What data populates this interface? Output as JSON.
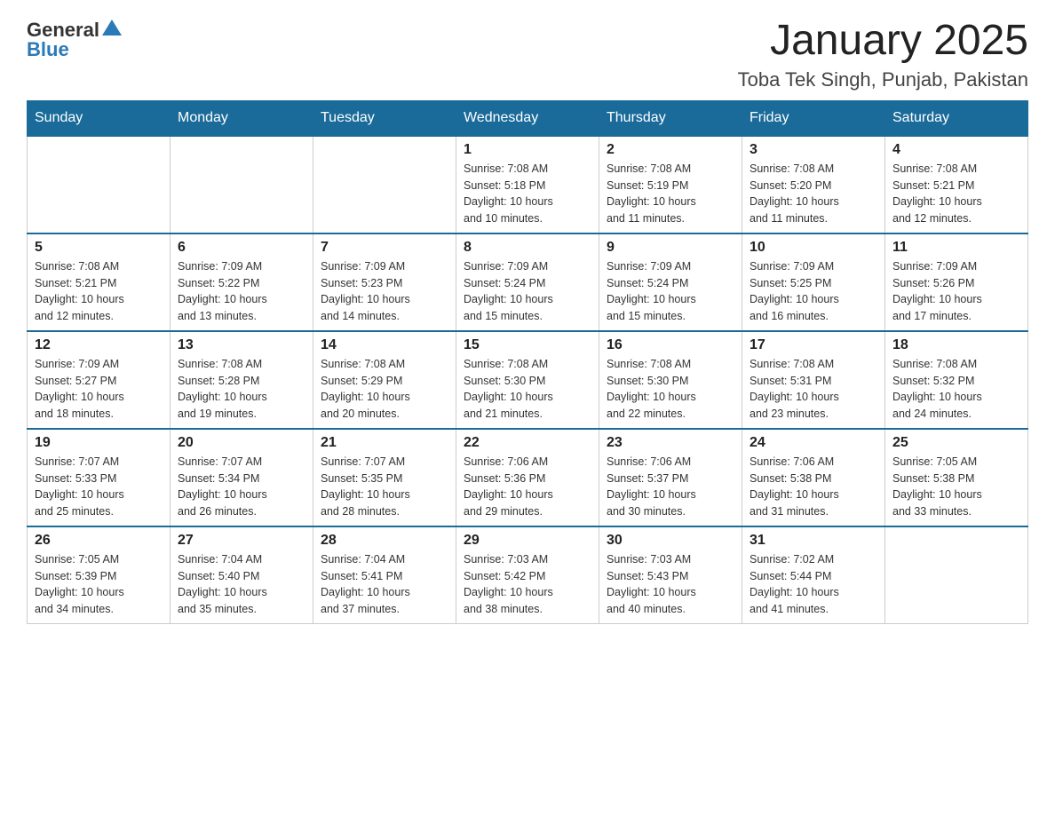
{
  "header": {
    "logo_general": "General",
    "logo_blue": "Blue",
    "month_title": "January 2025",
    "location": "Toba Tek Singh, Punjab, Pakistan"
  },
  "days_of_week": [
    "Sunday",
    "Monday",
    "Tuesday",
    "Wednesday",
    "Thursday",
    "Friday",
    "Saturday"
  ],
  "weeks": [
    [
      {
        "day": "",
        "info": ""
      },
      {
        "day": "",
        "info": ""
      },
      {
        "day": "",
        "info": ""
      },
      {
        "day": "1",
        "info": "Sunrise: 7:08 AM\nSunset: 5:18 PM\nDaylight: 10 hours\nand 10 minutes."
      },
      {
        "day": "2",
        "info": "Sunrise: 7:08 AM\nSunset: 5:19 PM\nDaylight: 10 hours\nand 11 minutes."
      },
      {
        "day": "3",
        "info": "Sunrise: 7:08 AM\nSunset: 5:20 PM\nDaylight: 10 hours\nand 11 minutes."
      },
      {
        "day": "4",
        "info": "Sunrise: 7:08 AM\nSunset: 5:21 PM\nDaylight: 10 hours\nand 12 minutes."
      }
    ],
    [
      {
        "day": "5",
        "info": "Sunrise: 7:08 AM\nSunset: 5:21 PM\nDaylight: 10 hours\nand 12 minutes."
      },
      {
        "day": "6",
        "info": "Sunrise: 7:09 AM\nSunset: 5:22 PM\nDaylight: 10 hours\nand 13 minutes."
      },
      {
        "day": "7",
        "info": "Sunrise: 7:09 AM\nSunset: 5:23 PM\nDaylight: 10 hours\nand 14 minutes."
      },
      {
        "day": "8",
        "info": "Sunrise: 7:09 AM\nSunset: 5:24 PM\nDaylight: 10 hours\nand 15 minutes."
      },
      {
        "day": "9",
        "info": "Sunrise: 7:09 AM\nSunset: 5:24 PM\nDaylight: 10 hours\nand 15 minutes."
      },
      {
        "day": "10",
        "info": "Sunrise: 7:09 AM\nSunset: 5:25 PM\nDaylight: 10 hours\nand 16 minutes."
      },
      {
        "day": "11",
        "info": "Sunrise: 7:09 AM\nSunset: 5:26 PM\nDaylight: 10 hours\nand 17 minutes."
      }
    ],
    [
      {
        "day": "12",
        "info": "Sunrise: 7:09 AM\nSunset: 5:27 PM\nDaylight: 10 hours\nand 18 minutes."
      },
      {
        "day": "13",
        "info": "Sunrise: 7:08 AM\nSunset: 5:28 PM\nDaylight: 10 hours\nand 19 minutes."
      },
      {
        "day": "14",
        "info": "Sunrise: 7:08 AM\nSunset: 5:29 PM\nDaylight: 10 hours\nand 20 minutes."
      },
      {
        "day": "15",
        "info": "Sunrise: 7:08 AM\nSunset: 5:30 PM\nDaylight: 10 hours\nand 21 minutes."
      },
      {
        "day": "16",
        "info": "Sunrise: 7:08 AM\nSunset: 5:30 PM\nDaylight: 10 hours\nand 22 minutes."
      },
      {
        "day": "17",
        "info": "Sunrise: 7:08 AM\nSunset: 5:31 PM\nDaylight: 10 hours\nand 23 minutes."
      },
      {
        "day": "18",
        "info": "Sunrise: 7:08 AM\nSunset: 5:32 PM\nDaylight: 10 hours\nand 24 minutes."
      }
    ],
    [
      {
        "day": "19",
        "info": "Sunrise: 7:07 AM\nSunset: 5:33 PM\nDaylight: 10 hours\nand 25 minutes."
      },
      {
        "day": "20",
        "info": "Sunrise: 7:07 AM\nSunset: 5:34 PM\nDaylight: 10 hours\nand 26 minutes."
      },
      {
        "day": "21",
        "info": "Sunrise: 7:07 AM\nSunset: 5:35 PM\nDaylight: 10 hours\nand 28 minutes."
      },
      {
        "day": "22",
        "info": "Sunrise: 7:06 AM\nSunset: 5:36 PM\nDaylight: 10 hours\nand 29 minutes."
      },
      {
        "day": "23",
        "info": "Sunrise: 7:06 AM\nSunset: 5:37 PM\nDaylight: 10 hours\nand 30 minutes."
      },
      {
        "day": "24",
        "info": "Sunrise: 7:06 AM\nSunset: 5:38 PM\nDaylight: 10 hours\nand 31 minutes."
      },
      {
        "day": "25",
        "info": "Sunrise: 7:05 AM\nSunset: 5:38 PM\nDaylight: 10 hours\nand 33 minutes."
      }
    ],
    [
      {
        "day": "26",
        "info": "Sunrise: 7:05 AM\nSunset: 5:39 PM\nDaylight: 10 hours\nand 34 minutes."
      },
      {
        "day": "27",
        "info": "Sunrise: 7:04 AM\nSunset: 5:40 PM\nDaylight: 10 hours\nand 35 minutes."
      },
      {
        "day": "28",
        "info": "Sunrise: 7:04 AM\nSunset: 5:41 PM\nDaylight: 10 hours\nand 37 minutes."
      },
      {
        "day": "29",
        "info": "Sunrise: 7:03 AM\nSunset: 5:42 PM\nDaylight: 10 hours\nand 38 minutes."
      },
      {
        "day": "30",
        "info": "Sunrise: 7:03 AM\nSunset: 5:43 PM\nDaylight: 10 hours\nand 40 minutes."
      },
      {
        "day": "31",
        "info": "Sunrise: 7:02 AM\nSunset: 5:44 PM\nDaylight: 10 hours\nand 41 minutes."
      },
      {
        "day": "",
        "info": ""
      }
    ]
  ]
}
